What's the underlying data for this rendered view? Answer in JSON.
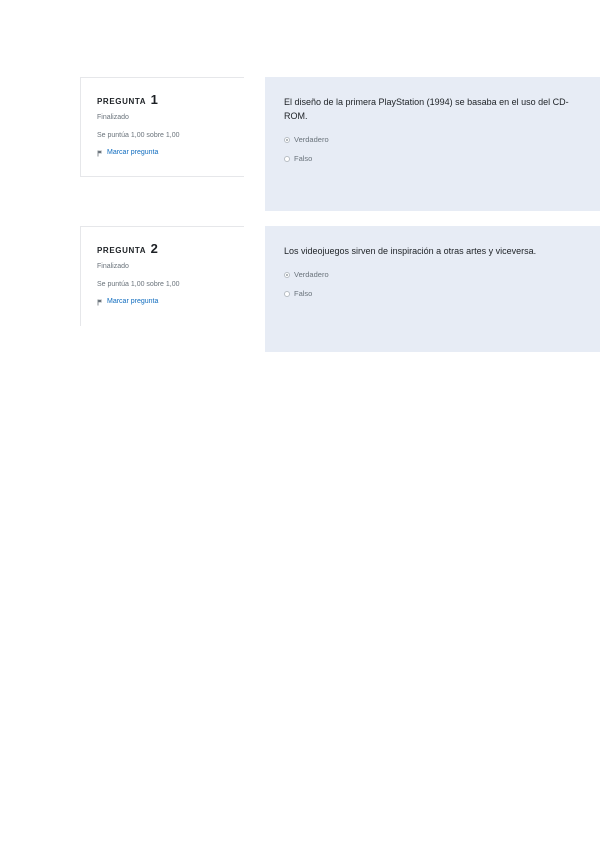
{
  "questions": [
    {
      "label": "PREGUNTA",
      "number": "1",
      "status": "Finalizado",
      "score": "Se puntúa 1,00 sobre 1,00",
      "flag_label": "Marcar pregunta",
      "text": "El diseño de la primera PlayStation (1994) se basaba en el uso del CD-ROM.",
      "answers": [
        {
          "label": "Verdadero",
          "selected": true
        },
        {
          "label": "Falso",
          "selected": false
        }
      ]
    },
    {
      "label": "PREGUNTA",
      "number": "2",
      "status": "Finalizado",
      "score": "Se puntúa 1,00 sobre 1,00",
      "flag_label": "Marcar pregunta",
      "text": "Los videojuegos sirven de inspiración a otras artes y viceversa.",
      "answers": [
        {
          "label": "Verdadero",
          "selected": true
        },
        {
          "label": "Falso",
          "selected": false
        }
      ]
    }
  ],
  "colors": {
    "content_bg": "#e7ecf5",
    "link": "#0f6cbf",
    "muted": "#6a737b"
  },
  "icons": {
    "flag": "flag-icon"
  }
}
